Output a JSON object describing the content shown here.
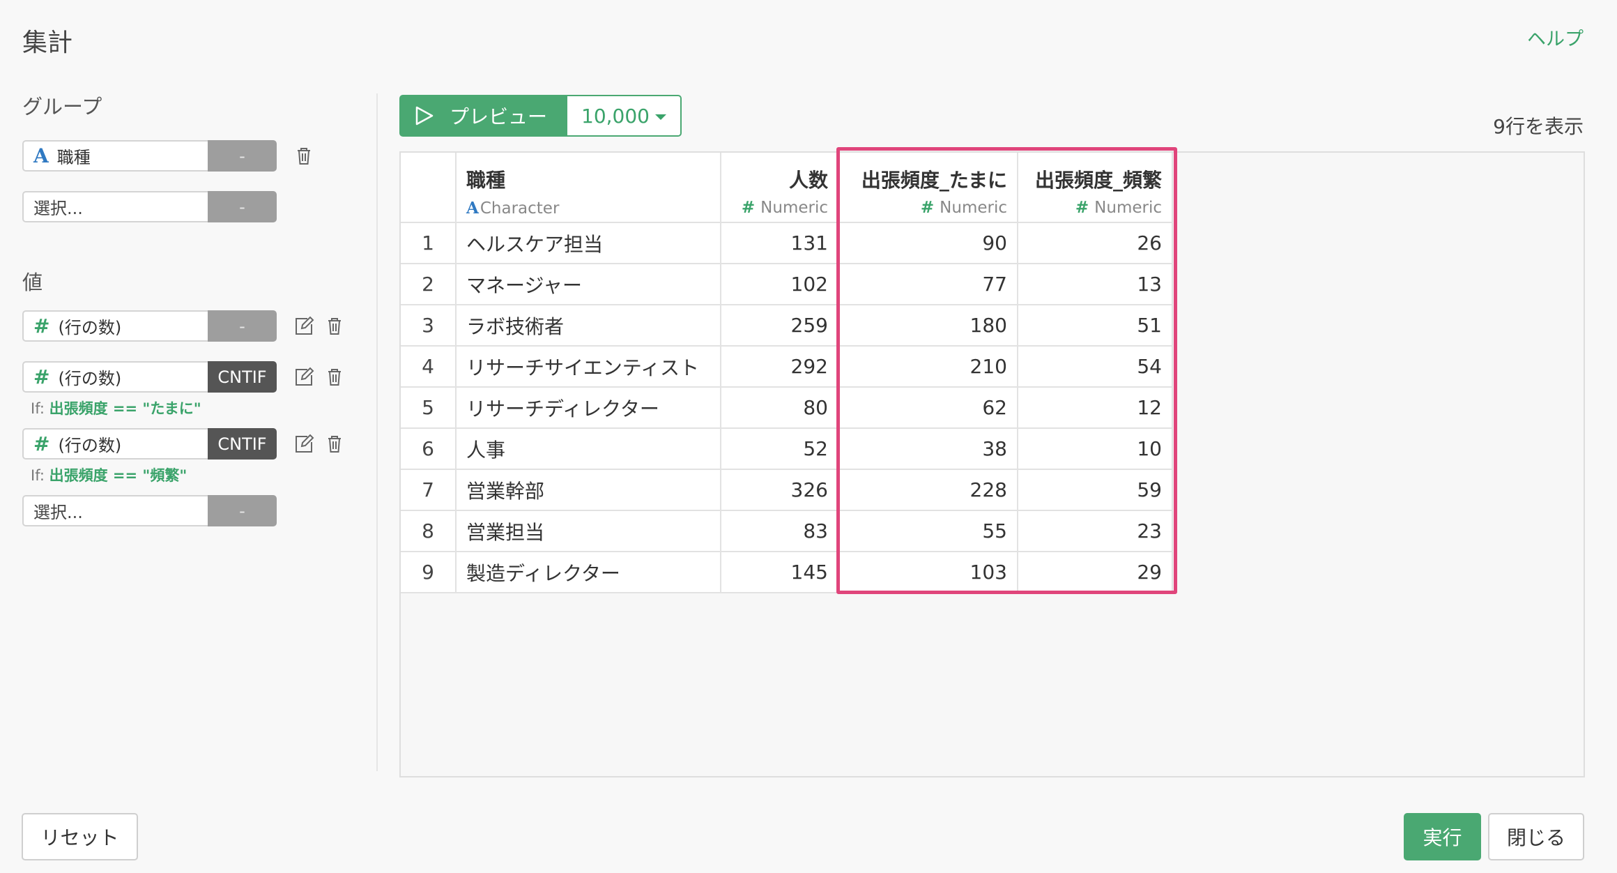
{
  "header": {
    "title": "集計",
    "help_label": "ヘルプ"
  },
  "group": {
    "label": "グループ",
    "items": [
      {
        "type_icon": "A",
        "value": "職種",
        "tag": "-"
      },
      {
        "placeholder": "選択...",
        "tag": "-"
      }
    ]
  },
  "values": {
    "label": "値",
    "items": [
      {
        "type_icon": "#",
        "value": "(行の数)",
        "tag": "-"
      },
      {
        "type_icon": "#",
        "value": "(行の数)",
        "tag": "CNTIF",
        "cond_prefix": "If:",
        "cond_text": "出張頻度 == \"たまに\""
      },
      {
        "type_icon": "#",
        "value": "(行の数)",
        "tag": "CNTIF",
        "cond_prefix": "If:",
        "cond_text": "出張頻度 == \"頻繁\""
      },
      {
        "placeholder": "選択...",
        "tag": "-"
      }
    ]
  },
  "preview": {
    "label": "プレビュー",
    "count": "10,000",
    "row_count": "9行を表示"
  },
  "table": {
    "columns": [
      {
        "name": "職種",
        "type_icon": "A",
        "type": "Character"
      },
      {
        "name": "人数",
        "type_icon": "#",
        "type": "Numeric"
      },
      {
        "name": "出張頻度_たまに",
        "type_icon": "#",
        "type": "Numeric"
      },
      {
        "name": "出張頻度_頻繁",
        "type_icon": "#",
        "type": "Numeric"
      }
    ],
    "rows": [
      [
        "1",
        "ヘルスケア担当",
        "131",
        "90",
        "26"
      ],
      [
        "2",
        "マネージャー",
        "102",
        "77",
        "13"
      ],
      [
        "3",
        "ラボ技術者",
        "259",
        "180",
        "51"
      ],
      [
        "4",
        "リサーチサイエンティスト",
        "292",
        "210",
        "54"
      ],
      [
        "5",
        "リサーチディレクター",
        "80",
        "62",
        "12"
      ],
      [
        "6",
        "人事",
        "52",
        "38",
        "10"
      ],
      [
        "7",
        "営業幹部",
        "326",
        "228",
        "59"
      ],
      [
        "8",
        "営業担当",
        "83",
        "55",
        "23"
      ],
      [
        "9",
        "製造ディレクター",
        "145",
        "103",
        "29"
      ]
    ]
  },
  "footer": {
    "reset_label": "リセット",
    "run_label": "実行",
    "close_label": "閉じる"
  },
  "colors": {
    "accent": "#4aa872",
    "highlight": "#e0457b",
    "character_icon": "#2f79c2"
  }
}
